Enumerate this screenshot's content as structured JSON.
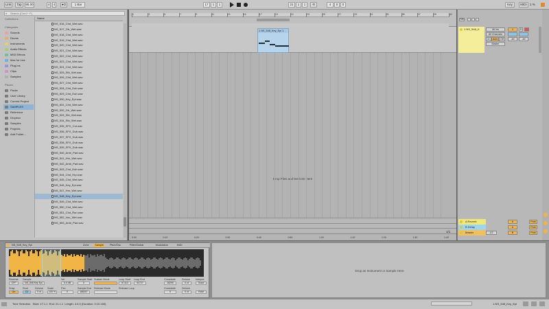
{
  "transport": {
    "link": "Link",
    "tap": "Tap",
    "tempo": "85.00",
    "sig_num": "4",
    "sig_den": "4",
    "metro": "●O",
    "quant": "1 Bar",
    "pos_bar": "17",
    "pos_beat": "1",
    "pos_sixteenth": "1",
    "loop_start_bar": "21",
    "loop_start_beat": "1",
    "loop_start_sixteenth": "1",
    "loop_len_bar": "4",
    "loop_len_beat": "0",
    "loop_len_sixteenth": "0",
    "key": "Key",
    "midi": "MIDI",
    "cpu": "1 %"
  },
  "browser": {
    "search_placeholder": "Search (Cmd + F)",
    "collections_title": "Collections",
    "categories_title": "Categories",
    "categories": [
      "Sounds",
      "Drums",
      "Instruments",
      "Audio Effects",
      "MIDI Effects",
      "Max for Live",
      "Plug-Ins",
      "Clips",
      "Samples"
    ],
    "places_title": "Places",
    "places": [
      "Packs",
      "User Library",
      "Current Project",
      "SAMPLES",
      "Reference",
      "Dropbox",
      "Samples",
      "Projects",
      "Add Folder..."
    ],
    "selected_place": "SAMPLES",
    "column_header": "Name",
    "files": [
      "NS_516_Chd_Wet.wav",
      "NS_517_Gtr_Wet.wav",
      "NS_518_Chd_Wet.wav",
      "NS_519_Chd_Wet.wav",
      "NS_520_Chd_Wet.wav",
      "NS_521_Chd_Wet.wav",
      "NS_522_Chd_Wet.wav",
      "NS_523_Chd_Wet.wav",
      "NS_524_Chd_Wet.wav",
      "NS_525_Stb_Wet.wav",
      "NS_526_Chd_Wet.wav",
      "NS_527_Chd_Wet.wav",
      "NS_528_Chd_Dub.wav",
      "NS_529_Chd_Dub.wav",
      "NS_530_Key_Epi.wav",
      "NS_531_Chd_Wet.wav",
      "NS_532_Gtr_Wet.wav",
      "NS_533_Stb_Wet.wav",
      "NS_534_Stb_Wet.wav",
      "NS_535_SFX_Cut.wav",
      "NS_536_SFX_Dub.wav",
      "NS_537_SFX_Dub.wav",
      "NS_538_SFX_Dub.wav",
      "NS_539_SFX_Dub.wav",
      "NS_540_Amb_Pad.wav",
      "NS_541_Hrn_Wet.wav",
      "NS_542_Amb_Pad.wav",
      "NS_543_Chd_Dub.wav",
      "NS_544_Chd_Hrp.wav",
      "NS_545_Chd_Wet.wav",
      "NS_546_Key_Epi.wav",
      "NS_547_Hrn_Wet.wav",
      "NS_548_Key_Epi.wav",
      "NS_549_Chd_Wet.wav",
      "NS_550_Chd_Wet.wav",
      "NS_551_Chd_Run.wav",
      "NS_552_Voc_Wet.wav",
      "NS_553_Amb_Pad.wav"
    ],
    "selected_file": "NS_548_Key_Epi.wav"
  },
  "arrangement": {
    "ruler_labels": [
      "1",
      "3",
      "5",
      "7",
      "9",
      "11",
      "13",
      "15",
      "17",
      "19",
      "21",
      "23",
      "25",
      "27",
      "29",
      "31",
      "33",
      "35",
      "37",
      "39",
      "41"
    ],
    "time_labels": [
      "0:00",
      "0:10",
      "0:20",
      "0:30",
      "0:40",
      "0:50",
      "1:00",
      "1:10",
      "1:20",
      "1:30",
      "1:40"
    ],
    "clip_name": "1 NS_548_Key_Epi 1",
    "drop_text": "Drop Files and Devices Here",
    "page_indicator": "1/1"
  },
  "mixer": {
    "track_name": "1 NS_548_K",
    "input_type": "All Ins",
    "input_channel": "All Channels",
    "monitor_in": "In",
    "monitor_auto": "Auto",
    "monitor_off": "Off",
    "output": "Master",
    "track_num": "1",
    "send_a": "-inf",
    "send_b": "-inf",
    "set_label": "Set",
    "returns": [
      {
        "name": "A Reverb",
        "color": "#f2e87a"
      },
      {
        "name": "B Delay",
        "color": "#9fd6ef"
      },
      {
        "name": "Master",
        "color": "#f0c060"
      }
    ],
    "return_ab": [
      "A",
      "A",
      "B"
    ],
    "post": "Post",
    "master_out": "1/2",
    "master_vol": "0",
    "solo": "S",
    "track_color": "#f4ee9a"
  },
  "detail": {
    "clip_name": "NS_548_Key_Epi",
    "tabs": [
      "Zone",
      "Sample",
      "Pitch/Osc",
      "Filter/Global",
      "Modulation",
      "MIDI"
    ],
    "wave_ruler": [
      "1",
      "1:00:2",
      "1:00:4",
      "1:01:2",
      "1:01:4",
      "1:02:2"
    ],
    "reverse": "Reverse",
    "reverse_val": "OFF",
    "sample_label": "Sample",
    "sample_val": "NS_548 Key Epi",
    "vol_label": "Vol",
    "vol_val": "0.0 dB",
    "sample_start_label": "Sample Start",
    "sample_start_val": "0",
    "sustain_mode_label": "Sustain Mode",
    "loop_start_label": "Loop Start",
    "loop_start_val": "67110",
    "loop_end_label": "Loop End",
    "loop_end_val": "92727",
    "crossfade_label": "Crossfade",
    "crossfade_val": "18290",
    "detune_label": "Detune",
    "detune_val": "0 ct",
    "interpol_label": "Interpol",
    "interpol_val": "Good",
    "snap_label": "Snap",
    "snap_val": "On",
    "root_label": "Root",
    "root_val": "C3",
    "detune2_label": "Detune",
    "detune2_val": "0 ct",
    "scale_label": "Scale",
    "scale_val": "100 %",
    "pan_label": "Pan",
    "pan_val": "0",
    "sample_end_label": "Sample End",
    "sample_end_val": "188307",
    "release_mode_label": "Release Mode",
    "release_loop_label": "Release Loop",
    "crossfade2_label": "Crossfade",
    "crossfade2_val": "0",
    "detune3_label": "Detune",
    "detune3_val": "0 ct",
    "ram_val": "RAM",
    "device_drop": "Drop an Instrument or Sample Here"
  },
  "status": {
    "left": "Time Selection",
    "start": "Start: 17.1.1",
    "end": "End: 21.1.1",
    "length": "Length: 4.0.0  (Duration: 0:10.165)",
    "track": "1-NS_548_Key_Epi"
  }
}
